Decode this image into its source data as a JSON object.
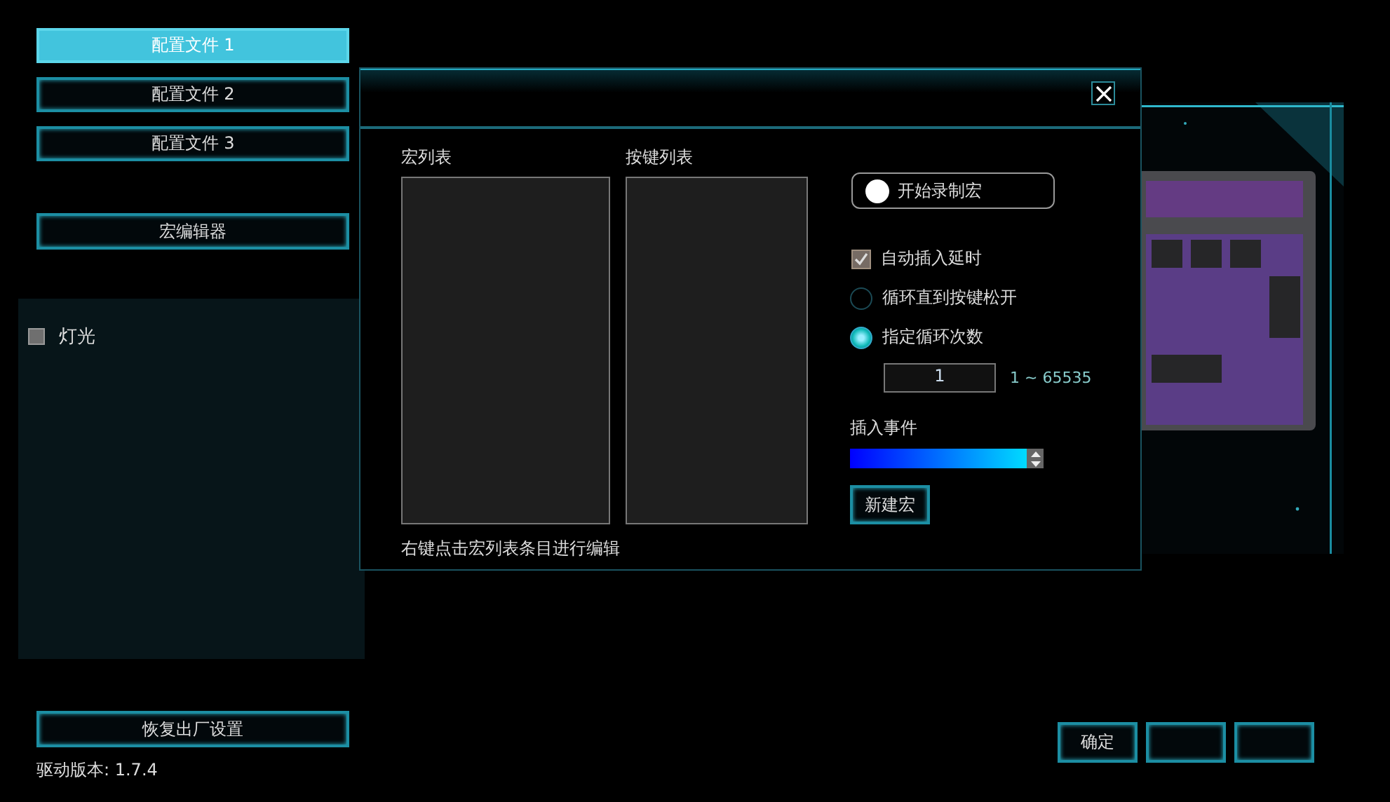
{
  "profiles": [
    {
      "label": "配置文件 1",
      "selected": true
    },
    {
      "label": "配置文件 2",
      "selected": false
    },
    {
      "label": "配置文件 3",
      "selected": false
    }
  ],
  "macro_editor_button": "宏编辑器",
  "lighting": {
    "label": "灯光",
    "checked": false
  },
  "restore_button": "恢复出厂设置",
  "version": "驱动版本: 1.7.4",
  "dialog": {
    "macro_list": {
      "label": "宏列表"
    },
    "key_list": {
      "label": "按键列表"
    },
    "hint": "右键点击宏列表条目进行编辑",
    "record_button": "开始录制宏",
    "options": [
      {
        "kind": "checkbox",
        "label": "自动插入延时",
        "checked": true
      },
      {
        "kind": "radio",
        "label": "循环直到按键松开",
        "selected": false
      },
      {
        "kind": "radio",
        "label": "指定循环次数",
        "selected": true
      }
    ],
    "loop_count": {
      "value": "1",
      "range": "1 ~ 65535"
    },
    "insert_event": {
      "label": "插入事件"
    },
    "new_macro_button": "新建宏"
  },
  "footer_buttons": [
    {
      "kind": "labeled",
      "label": "确定"
    },
    {
      "kind": "blank"
    },
    {
      "kind": "blank"
    }
  ]
}
